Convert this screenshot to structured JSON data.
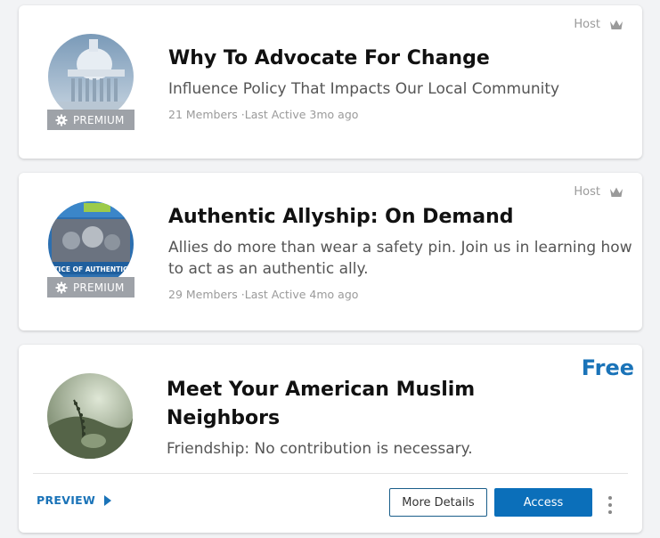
{
  "groups": [
    {
      "title": "Why To Advocate For Change",
      "subtitle": "Influence Policy That Impacts Our Local Community",
      "members": "21 Members",
      "separator": "·",
      "last_active": "Last Active 3mo ago",
      "badge": "PREMIUM",
      "host_label": "Host",
      "avatar_icon": "capitol-building-image"
    },
    {
      "title": "Authentic Allyship: On Demand",
      "subtitle_line1": "Allies do more than wear a safety pin. Join us in learning how",
      "subtitle_line2": "to act as an authentic ally.",
      "members": "29 Members",
      "separator": "·",
      "last_active": "Last Active 4mo ago",
      "badge": "PREMIUM",
      "host_label": "Host",
      "avatar_icon": "allyship-poster-image",
      "avatar_caption": "TICE OF AUTHENTIC"
    },
    {
      "title_line1": "Meet Your American Muslim",
      "title_line2": "Neighbors",
      "subtitle": "Friendship: No contribution is necessary.",
      "price": "Free",
      "preview_label": "PREVIEW",
      "details_label": "More Details",
      "access_label": "Access",
      "avatar_icon": "prayer-beads-image"
    }
  ],
  "colors": {
    "accent": "#1a73b8",
    "button_primary": "#0b6fba",
    "badge_bg": "#9ea2a8"
  }
}
